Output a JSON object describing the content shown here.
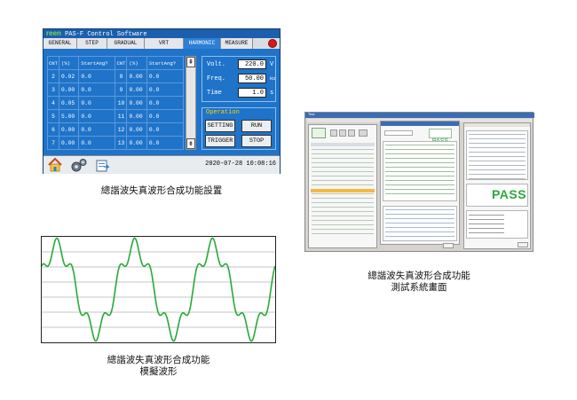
{
  "panel_a": {
    "logo": "reen",
    "title": "PAS-F Control Software",
    "tabs": [
      "GENERAL",
      "STEP",
      "GRADUAL",
      "VRT",
      "HARMONIC",
      "MEASURE"
    ],
    "active_tab": "HARMONIC",
    "table_headers": [
      "CNT",
      "(%)",
      "StartAng?",
      "CNT",
      "(%)",
      "StartAng?"
    ],
    "rows": [
      {
        "cnt1": "2",
        "pct1": "0.02",
        "ang1": "0.0",
        "cnt2": "8",
        "pct2": "0.00",
        "ang2": "0.0"
      },
      {
        "cnt1": "3",
        "pct1": "0.00",
        "ang1": "0.0",
        "cnt2": "9",
        "pct2": "0.00",
        "ang2": "0.0"
      },
      {
        "cnt1": "4",
        "pct1": "0.05",
        "ang1": "0.0",
        "cnt2": "10",
        "pct2": "0.00",
        "ang2": "0.0"
      },
      {
        "cnt1": "5",
        "pct1": "5.00",
        "ang1": "0.0",
        "cnt2": "11",
        "pct2": "0.00",
        "ang2": "0.0"
      },
      {
        "cnt1": "6",
        "pct1": "0.00",
        "ang1": "0.0",
        "cnt2": "12",
        "pct2": "0.00",
        "ang2": "0.0"
      },
      {
        "cnt1": "7",
        "pct1": "0.00",
        "ang1": "0.0",
        "cnt2": "13",
        "pct2": "0.00",
        "ang2": "0.0"
      }
    ],
    "scroll_up": "⇞",
    "scroll_down": "⇟",
    "volt_label": "Volt.",
    "volt_value": "220.0",
    "volt_unit": "V",
    "freq_label": "Freq.",
    "freq_value": "50.00",
    "freq_unit": "Hz",
    "time_label": "Time",
    "time_value": "1.0",
    "time_unit": "s",
    "operation_label": "Operation",
    "btn_setting": "SETTING",
    "btn_run": "RUN",
    "btn_trigger": "TRIGGER",
    "btn_stop": "STOP",
    "datetime": "2020-07-28 10:08:16",
    "icons": [
      "home-icon",
      "gears-icon",
      "export-icon"
    ],
    "colors": {
      "panel": "#1f73c9",
      "active_tab": "#2e7fd6",
      "operation_label": "#ffd400",
      "record": "#d81818"
    }
  },
  "caption_a": "總諧波失真波形合成功能設置",
  "panel_b": {
    "waveform": "distorted sine with 5th harmonic",
    "line_color": "#2aa83a",
    "cycles": 3,
    "grid": true
  },
  "caption_b": [
    "總諧波失真波形合成功能",
    "模擬波形"
  ],
  "panel_c": {
    "window_title": "Test",
    "pass_big": "PASS",
    "pass_small": "PASS",
    "colors": {
      "pass": "#2aa83a",
      "highlight": "#f5b942",
      "titlebar": "#3b6db4"
    }
  },
  "caption_c": [
    "總諧波失真波形合成功能",
    "測試系統畫面"
  ]
}
